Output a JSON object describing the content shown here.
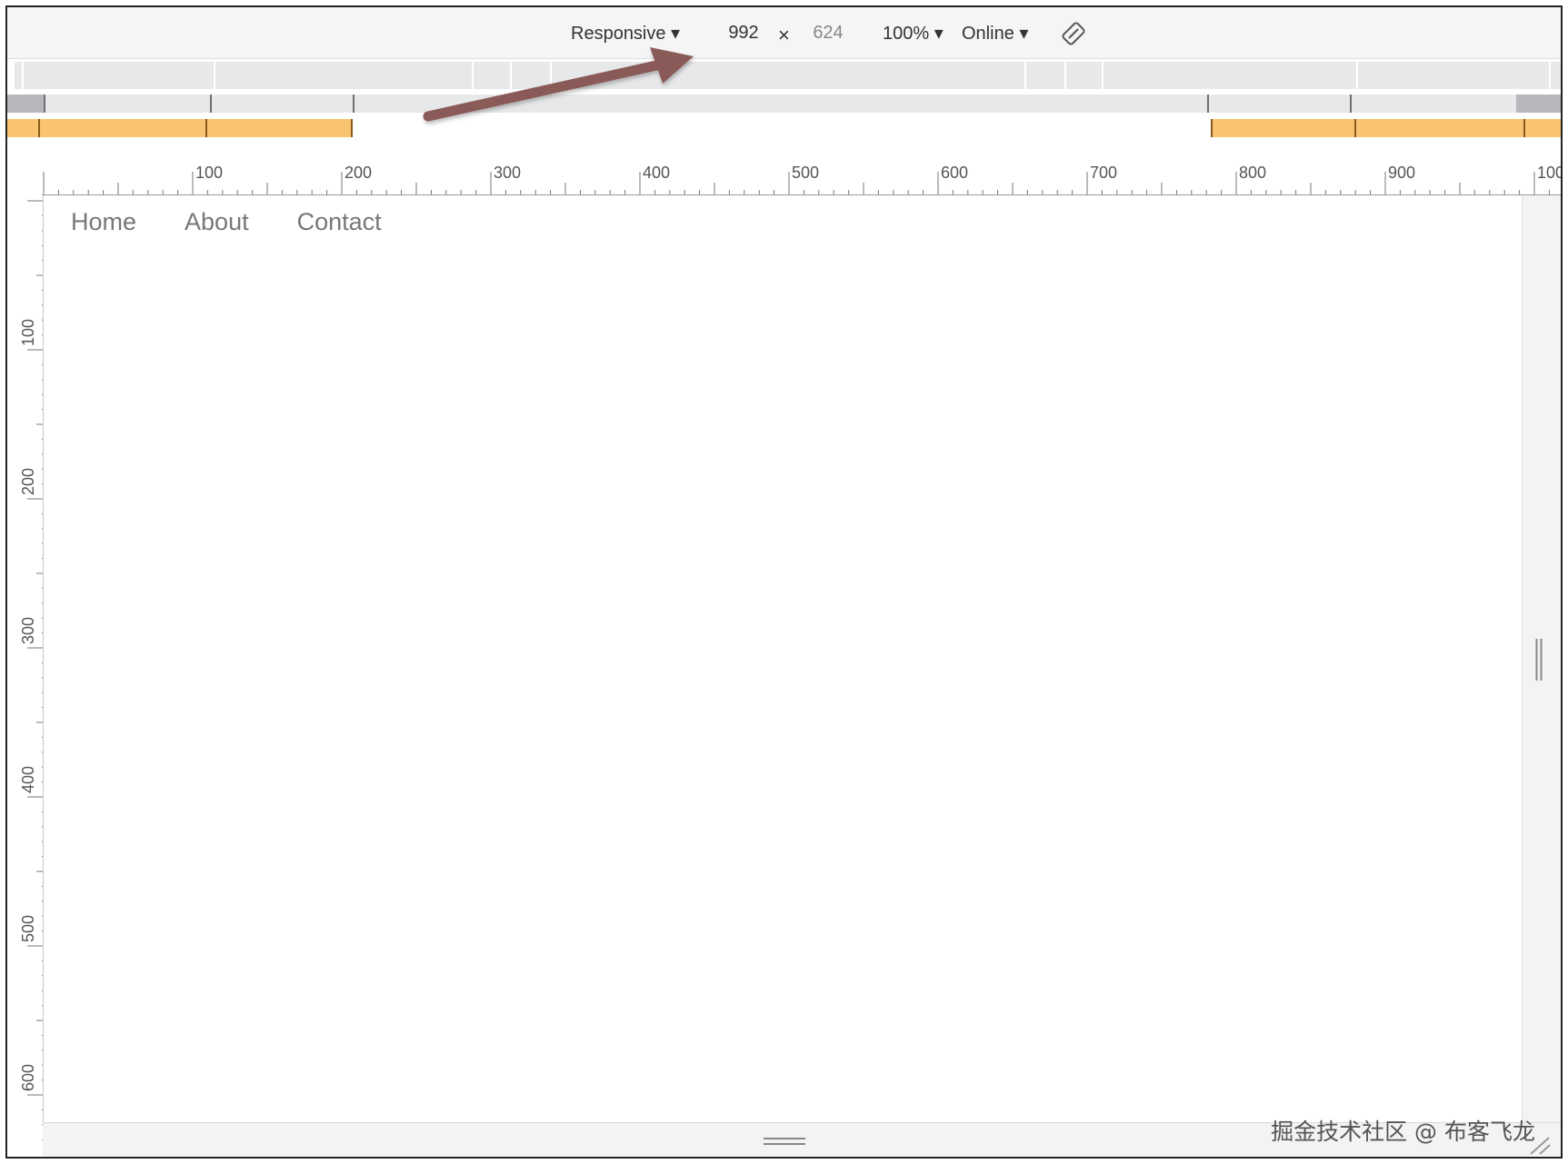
{
  "toolbar": {
    "device": "Responsive ▾",
    "width": "992",
    "times": "×",
    "height": "624",
    "zoom": "100% ▾",
    "network": "Online ▾",
    "rotate_icon": "rotate-icon"
  },
  "rulers": {
    "horizontal_labels": [
      "100",
      "200",
      "300",
      "400",
      "500",
      "600",
      "700",
      "800",
      "900",
      "100"
    ],
    "vertical_labels": [
      "100",
      "200",
      "300",
      "400",
      "500",
      "600"
    ]
  },
  "page": {
    "nav": [
      "Home",
      "About",
      "Contact"
    ]
  },
  "annotation": {
    "arrow_color": "#8a5a58"
  },
  "colors": {
    "media_query_max_width": "#f8c471",
    "media_query_min_width": "#b7b8bb",
    "media_query_bar": "#e7e8e9"
  },
  "watermark": "掘金技术社区 @ 布客飞龙"
}
